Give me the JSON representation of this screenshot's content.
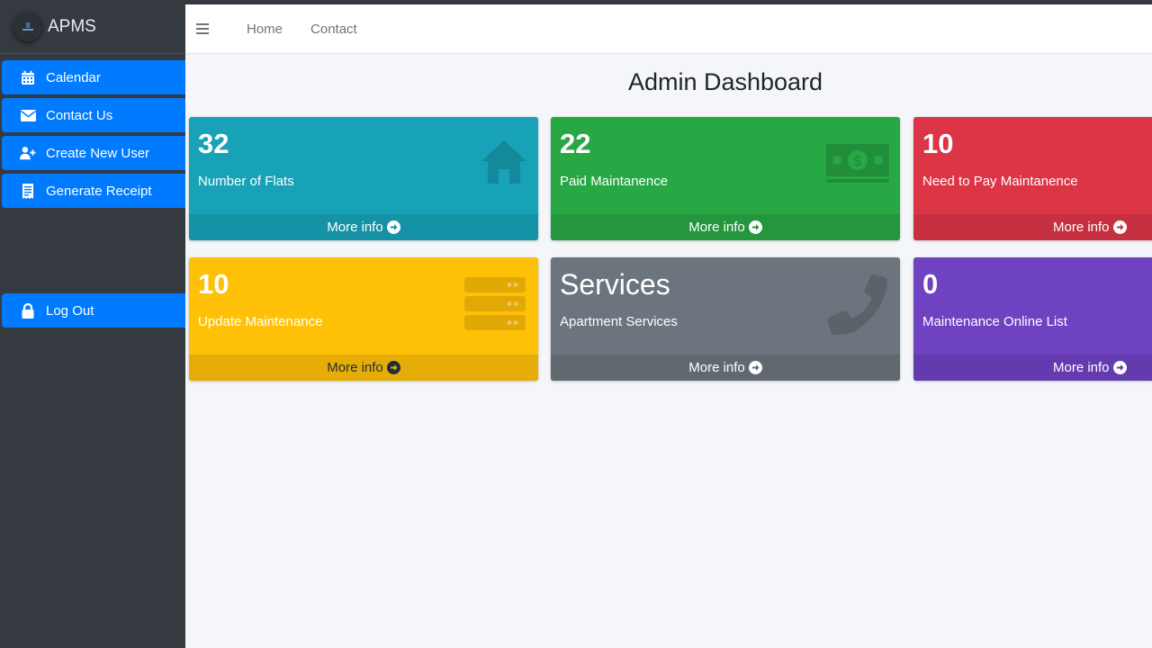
{
  "brand": {
    "name": "APMS"
  },
  "sidebar": {
    "items": [
      {
        "label": "Calendar",
        "icon": "calendar-icon"
      },
      {
        "label": "Contact Us",
        "icon": "envelope-icon"
      },
      {
        "label": "Create New User",
        "icon": "user-plus-icon"
      },
      {
        "label": "Generate Receipt",
        "icon": "receipt-icon"
      }
    ],
    "logout": {
      "label": "Log Out",
      "icon": "lock-icon"
    }
  },
  "navbar": {
    "links": [
      "Home",
      "Contact"
    ]
  },
  "main": {
    "title": "Admin Dashboard",
    "cards": [
      {
        "value": "32",
        "label": "Number of Flats",
        "footer": "More info",
        "icon": "home-icon",
        "color": "#17a2b8"
      },
      {
        "value": "22",
        "label": "Paid Maintanence",
        "footer": "More info",
        "icon": "money-bill-icon",
        "color": "#28a745"
      },
      {
        "value": "10",
        "label": "Need to Pay Maintanence",
        "footer": "More info",
        "icon": "none",
        "color": "#dc3545"
      },
      {
        "value": "10",
        "label": "Update Maintenance",
        "footer": "More info",
        "icon": "server-icon",
        "color": "#ffc107"
      },
      {
        "value": "Services",
        "label": "Apartment Services",
        "footer": "More info",
        "icon": "phone-icon",
        "color": "#6c757d"
      },
      {
        "value": "0",
        "label": "Maintenance Online List",
        "footer": "More info",
        "icon": "none",
        "color": "#6f42c1"
      }
    ]
  }
}
